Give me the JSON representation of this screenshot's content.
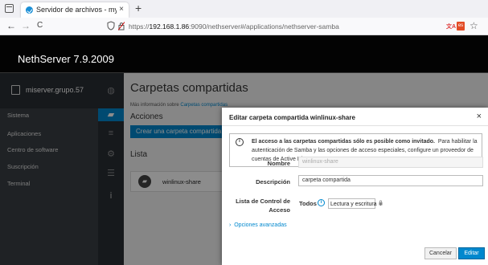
{
  "browser": {
    "tab_title": "Servidor de archivos - my",
    "tab_close": "×",
    "new_tab": "+",
    "back": "←",
    "forward": "→",
    "reload": "C",
    "url_prefix": "https://",
    "url_host": "192.168.1.86",
    "url_rest": ":9090/nethserver#/applications/nethserver-samba",
    "translate_badge": "es",
    "star": "☆"
  },
  "header": {
    "title": "NethServer 7.9.2009"
  },
  "sidebar": {
    "host": "miserver.grupo.57",
    "items": [
      {
        "label": "Sistema"
      },
      {
        "label": "Aplicaciones"
      },
      {
        "label": "Centro de software"
      },
      {
        "label": "Suscripción"
      },
      {
        "label": "Terminal"
      }
    ]
  },
  "main": {
    "title": "Carpetas compartidas",
    "more_prefix": "Más información sobre",
    "more_link": "Carpetas compartidas",
    "actions_title": "Acciones",
    "create_label": "Crear una carpeta compartida",
    "list_title": "Lista",
    "share_name": "winlinux-share"
  },
  "modal": {
    "title": "Editar carpeta compartida winlinux-share",
    "close": "×",
    "info_bold": "El acceso a las carpetas compartidas sólo es posible como invitado.",
    "info_rest": "Para habilitar la autenticación de Samba y las opciones de acceso especiales, configure un proveedor de cuentas de Active Directory.",
    "name_label": "Nombre",
    "name_value": "winlinux-share",
    "desc_label": "Descripción",
    "desc_value": "carpeta compartida",
    "acl_label": "Lista de Control de Acceso",
    "acl_who": "Todos",
    "acl_select": "Lectura y escritura",
    "advanced": "Opciones avanzadas",
    "cancel": "Cancelar",
    "edit": "Editar"
  },
  "colors": {
    "accent": "#0088ce",
    "sidebar": "#393f44",
    "header": "#030303"
  }
}
